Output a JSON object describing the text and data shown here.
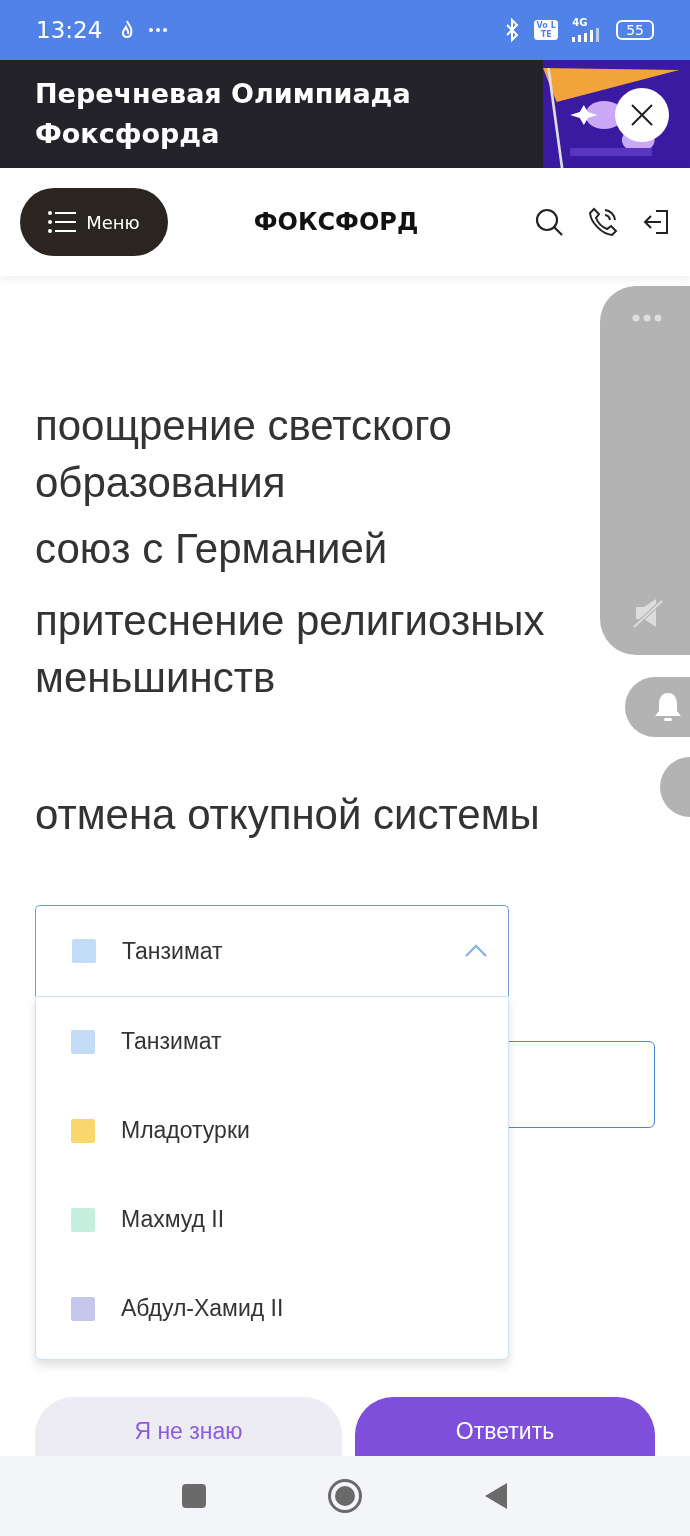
{
  "status_bar": {
    "time": "13:24",
    "lte_badge": "Vo LTE",
    "network": "4G",
    "battery": "55"
  },
  "banner": {
    "title": "Перечневая Олимпиада Фоксфорда"
  },
  "header": {
    "menu_button": "Меню",
    "logo": "ФОКСФОРД"
  },
  "statements": [
    "поощрение светского образования",
    "союз с Германией",
    "притеснение религиозных меньшинств",
    "отмена откупной системы"
  ],
  "dropdown": {
    "expanded": true,
    "value": "Танзимат",
    "color": "#c2dcf7",
    "options": [
      {
        "label": "Танзимат",
        "color": "#c2dcf7"
      },
      {
        "label": "Младотурки",
        "color": "#f9d66e"
      },
      {
        "label": "Махмуд II",
        "color": "#c5eedf"
      },
      {
        "label": "Абдул-Хамид II",
        "color": "#c6c6ec"
      }
    ]
  },
  "buttons": {
    "skip": "Я не знаю",
    "submit": "Ответить"
  }
}
